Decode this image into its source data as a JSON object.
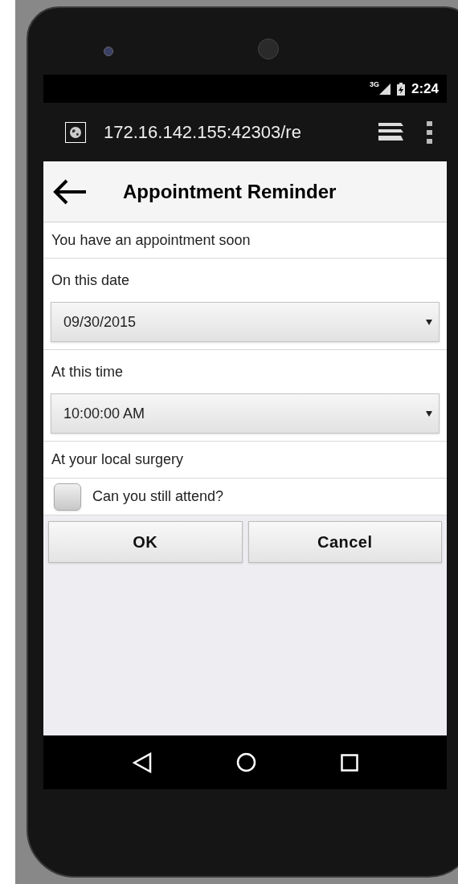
{
  "status_bar": {
    "network": "3G",
    "time": "2:24"
  },
  "address_bar": {
    "url": "172.16.142.155:42303/re"
  },
  "header": {
    "title": "Appointment Reminder"
  },
  "message": "You have an appointment soon",
  "fields": [
    {
      "label": "On this date",
      "value": "09/30/2015"
    },
    {
      "label": "At this time",
      "value": "10:00:00 AM"
    }
  ],
  "location": "At your local surgery",
  "attend": {
    "label": "Can you still attend?",
    "checked": false
  },
  "buttons": [
    "OK",
    "Cancel"
  ]
}
